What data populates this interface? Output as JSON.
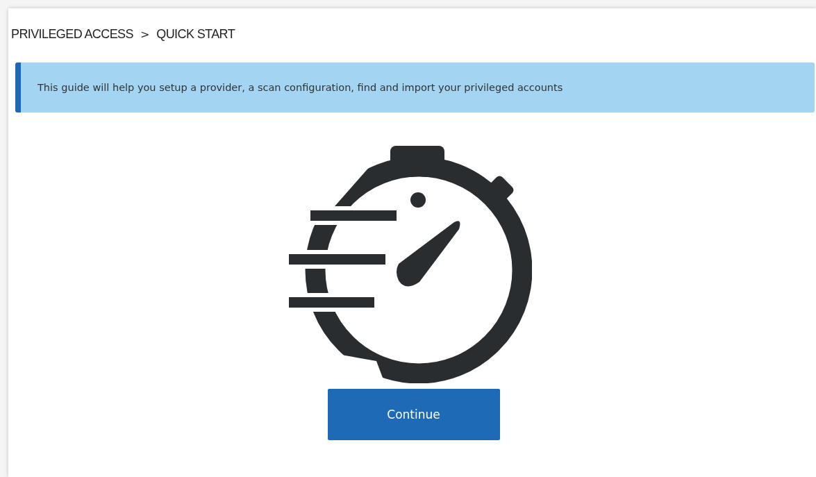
{
  "breadcrumb": [
    {
      "label": "PRIVILEGED ACCESS"
    },
    {
      "label": "QUICK START"
    }
  ],
  "breadcrumb_separator": ">",
  "info_banner": {
    "text": "This guide will help you setup a provider, a scan configuration, find and import your privileged accounts"
  },
  "continue_button": {
    "label": "Continue"
  }
}
